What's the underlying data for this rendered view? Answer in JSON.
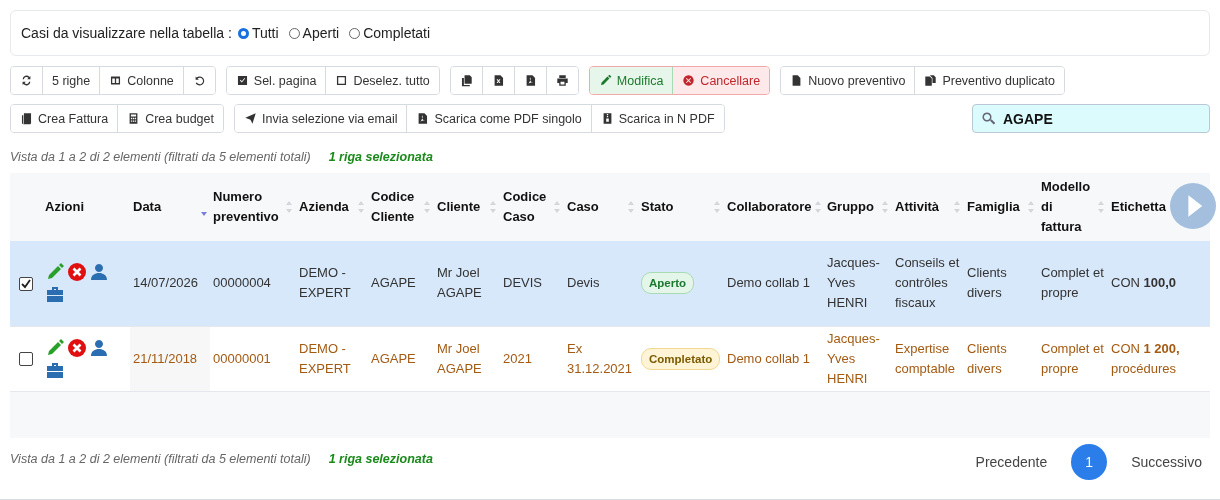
{
  "filter": {
    "label": "Casi da visualizzare nella tabella :",
    "options": [
      {
        "label": "Tutti",
        "selected": true
      },
      {
        "label": "Aperti",
        "selected": false
      },
      {
        "label": "Completati",
        "selected": false
      }
    ]
  },
  "toolbar": [
    [
      {
        "kind": "default"
      },
      {
        "label": "5 righe",
        "kind": "default"
      },
      {
        "label": "Colonne",
        "kind": "default"
      },
      {
        "kind": "default"
      }
    ],
    [
      {
        "label": "Sel. pagina",
        "kind": "default"
      },
      {
        "label": "Deselez. tutto",
        "kind": "default"
      }
    ],
    [
      {
        "kind": "default"
      },
      {
        "kind": "default"
      },
      {
        "kind": "default"
      },
      {
        "kind": "default"
      }
    ],
    [
      {
        "label": "Modifica",
        "kind": "success"
      },
      {
        "label": "Cancellare",
        "kind": "danger"
      }
    ],
    [
      {
        "label": "Nuovo preventivo",
        "kind": "default"
      },
      {
        "label": "Preventivo duplicato",
        "kind": "default"
      }
    ],
    [
      {
        "label": "Crea Fattura",
        "kind": "default"
      },
      {
        "label": "Crea budget",
        "kind": "default"
      }
    ],
    [
      {
        "label": "Invia selezione via email",
        "kind": "default"
      },
      {
        "label": "Scarica come PDF singolo",
        "kind": "default"
      },
      {
        "label": "Scarica in N PDF",
        "kind": "default"
      }
    ]
  ],
  "search": {
    "value": "AGAPE"
  },
  "info_top": {
    "text": "Vista da 1 a 2 di 2 elementi (filtrati da 5 elementi totali)",
    "selection": "1 riga selezionata"
  },
  "table": {
    "actions_header": "Azioni",
    "columns": [
      {
        "label": "Data",
        "sorted": true
      },
      {
        "label": "Numero preventivo",
        "sorted": false
      },
      {
        "label": "Azienda",
        "sorted": false
      },
      {
        "label": "Codice Cliente",
        "sorted": false
      },
      {
        "label": "Cliente",
        "sorted": false
      },
      {
        "label": "Codice Caso",
        "sorted": false
      },
      {
        "label": "Caso",
        "sorted": false
      },
      {
        "label": "Stato",
        "sorted": false
      },
      {
        "label": "Collaboratore",
        "sorted": false
      },
      {
        "label": "Gruppo",
        "sorted": false
      },
      {
        "label": "Attività",
        "sorted": false
      },
      {
        "label": "Famiglia",
        "sorted": false
      },
      {
        "label": "Modello di fattura",
        "sorted": false
      },
      {
        "label": "Etichetta"
      }
    ],
    "rows": [
      {
        "selected": true,
        "cells": [
          "14/07/2026",
          "00000004",
          "DEMO - EXPERT",
          "AGAPE",
          "Mr Joel AGAPE",
          "DEVIS",
          "Devis",
          "Aperto",
          "Demo collab 1",
          "Jacques-Yves HENRI",
          "Conseils et contrôles fiscaux",
          "Clients divers",
          "Complet et propre",
          "CON **100,0**"
        ],
        "kind": "open"
      },
      {
        "selected": false,
        "cells": [
          "21/11/2018",
          "00000001",
          "DEMO - EXPERT",
          "AGAPE",
          "Mr Joel AGAPE",
          "2021",
          "Ex 31.12.2021",
          "Completato",
          "Demo collab 1",
          "Jacques-Yves HENRI",
          "Expertise comptable",
          "Clients divers",
          "Complet et propre",
          "CON **1 200,**\nprocédures"
        ],
        "kind": "completed"
      }
    ]
  },
  "info_bottom": {
    "text": "Vista da 1 a 2 di 2 elementi (filtrati da 5 elementi totali)",
    "selection": "1 riga selezionata"
  },
  "pagination": {
    "previous": "Precedente",
    "pages": [
      {
        "label": "1",
        "selected": true
      }
    ],
    "next": "Successivo"
  }
}
